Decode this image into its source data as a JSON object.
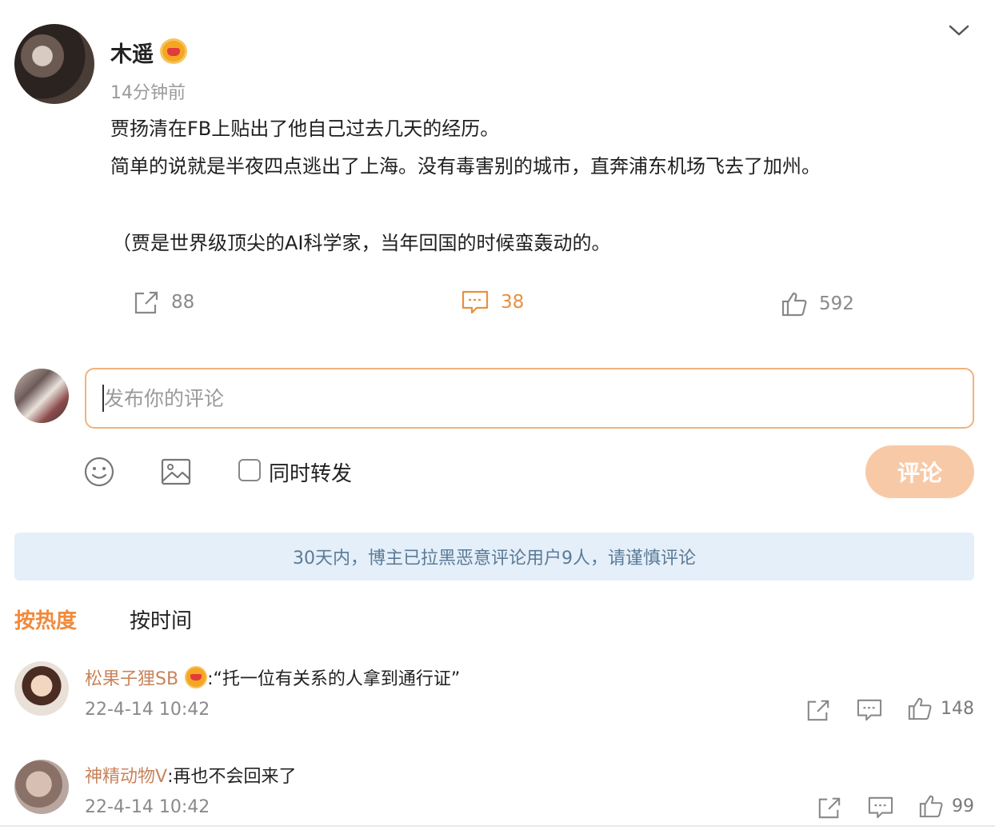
{
  "post": {
    "author": "木遥",
    "time": "14分钟前",
    "lines": [
      "贾扬清在FB上贴出了他自己过去几天的经历。",
      "简单的说就是半夜四点逃出了上海。没有毒害别的城市，直奔浦东机场飞去了加州。",
      "（贾是世界级顶尖的AI科学家，当年回国的时候蛮轰动的。"
    ],
    "reposts": "88",
    "comments": "38",
    "likes": "592"
  },
  "composer": {
    "placeholder": "发布你的评论",
    "forward_label": "同时转发",
    "submit_label": "评论"
  },
  "notice": "30天内，博主已拉黑恶意评论用户9人，请谨慎评论",
  "sort": {
    "hot": "按热度",
    "time": "按时间"
  },
  "comment_list": [
    {
      "user": "松果子狸SB",
      "text": ":“托一位有关系的人拿到通行证”",
      "time": "22-4-14 10:42",
      "likes": "148"
    },
    {
      "user": "神精动物V",
      "text": ":再也不会回来了",
      "time": "22-4-14 10:42",
      "likes": "99"
    }
  ],
  "colors": {
    "accent": "#f08a3c",
    "username": "#c9845b",
    "notice_bg": "#e4eff9",
    "notice_text": "#5b7a97"
  }
}
